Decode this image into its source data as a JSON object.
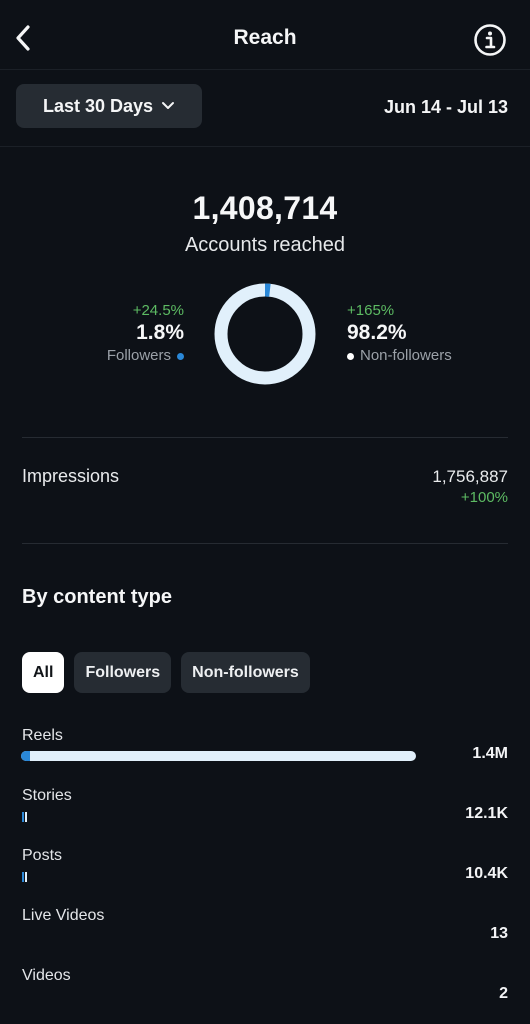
{
  "header": {
    "title": "Reach",
    "back_icon": "chevron-left-icon",
    "info_icon": "info-circle-icon"
  },
  "range": {
    "label": "Last 30 Days",
    "chevron_icon": "chevron-down-icon",
    "dates": "Jun 14 - Jul 13"
  },
  "summary": {
    "accounts_reached": "1,408,714",
    "label": "Accounts reached",
    "followers": {
      "change": "+24.5%",
      "pct": "1.8%",
      "label": "Followers",
      "color": "#2a88d8"
    },
    "non_followers": {
      "change": "+165%",
      "pct": "98.2%",
      "label": "Non-followers",
      "color": "#ffffff"
    }
  },
  "impressions": {
    "label": "Impressions",
    "value": "1,756,887",
    "change": "+100%"
  },
  "content_type": {
    "title": "By content type",
    "tabs": [
      {
        "label": "All",
        "active": true
      },
      {
        "label": "Followers",
        "active": false
      },
      {
        "label": "Non-followers",
        "active": false
      }
    ],
    "rows": [
      {
        "name": "Reels",
        "value": "1.4M",
        "fraction": 0.975
      },
      {
        "name": "Stories",
        "value": "12.1K",
        "fraction": 0.008
      },
      {
        "name": "Posts",
        "value": "10.4K",
        "fraction": 0.007
      },
      {
        "name": "Live Videos",
        "value": "13",
        "fraction": 0
      },
      {
        "name": "Videos",
        "value": "2",
        "fraction": 0
      }
    ]
  },
  "colors": {
    "background": "#0d1117",
    "accent_blue": "#2a88d8",
    "positive_green": "#5dbb63",
    "bar_light": "#e1f0fb"
  }
}
